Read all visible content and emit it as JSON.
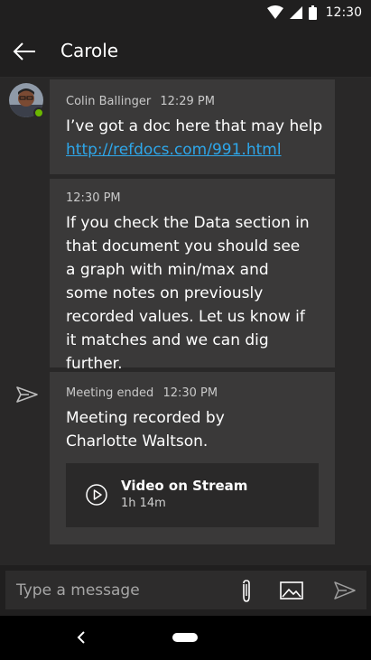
{
  "status": {
    "time": "12:30"
  },
  "header": {
    "title": "Carole"
  },
  "messages": [
    {
      "sender": "Colin Ballinger",
      "time": "12:29 PM",
      "text": "I’ve got a doc here that may help",
      "link": "http://refdocs.com/991.html"
    },
    {
      "time": "12:30 PM",
      "text": "If you check the Data section in that document you should see a graph with min/max and some notes on previously recorded values. Let us know if it matches and we can dig further."
    }
  ],
  "meeting": {
    "label": "Meeting ended",
    "time": "12:30 PM",
    "text": "Meeting recorded by Charlotte Waltson.",
    "card": {
      "title": "Video on Stream",
      "duration": "1h 14m"
    }
  },
  "composer": {
    "placeholder": "Type a message"
  },
  "colors": {
    "accent": "#2ea7ea",
    "presence": "#6bb700"
  }
}
